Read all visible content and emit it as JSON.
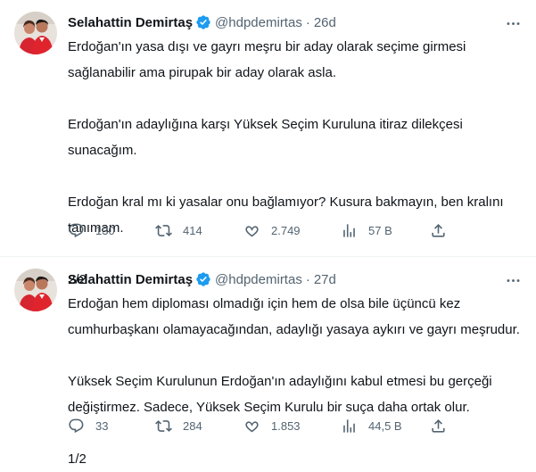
{
  "tweets": [
    {
      "display_name": "Selahattin Demirtaş",
      "handle": "@hdpdemirtas",
      "separator": "·",
      "time": "26d",
      "paragraphs": [
        [
          "Erdoğan'ın yasa dışı ve gayrı meşru bir aday olarak seçime girmesi",
          "sağlanabilir ama pirupak bir aday olarak asla."
        ],
        [
          "Erdoğan'ın adaylığına karşı Yüksek Seçim Kuruluna itiraz dilekçesi",
          "sunacağım."
        ],
        [
          "Erdoğan kral mı ki yasalar onu bağlamıyor? Kusura bakmayın, ben kralını",
          "tanımam."
        ],
        [
          "2/2"
        ]
      ],
      "replies": "130",
      "retweets": "414",
      "likes": "2.749",
      "views": "57 B"
    },
    {
      "display_name": "Selahattin Demirtaş",
      "handle": "@hdpdemirtas",
      "separator": "·",
      "time": "27d",
      "paragraphs": [
        [
          "Erdoğan hem diploması olmadığı için hem de olsa bile üçüncü kez",
          "cumhurbaşkanı olamayacağından, adaylığı yasaya aykırı ve gayrı meşrudur."
        ],
        [
          "Yüksek Seçim Kurulunun Erdoğan'ın adaylığını kabul etmesi bu gerçeği",
          "değiştirmez. Sadece, Yüksek Seçim Kurulu bir suça daha ortak olur."
        ],
        [
          "1/2"
        ]
      ],
      "replies": "33",
      "retweets": "284",
      "likes": "1.853",
      "views": "44,5 B"
    }
  ],
  "icons": {
    "verified": "verified-badge-icon",
    "more": "more-horizontal-icon",
    "reply": "reply-icon",
    "retweet": "retweet-icon",
    "like": "heart-icon",
    "views": "views-icon",
    "share": "share-icon"
  },
  "colors": {
    "text": "#0f1419",
    "secondary": "#536471",
    "verified": "#1d9bf0",
    "divider": "#eff3f4"
  }
}
